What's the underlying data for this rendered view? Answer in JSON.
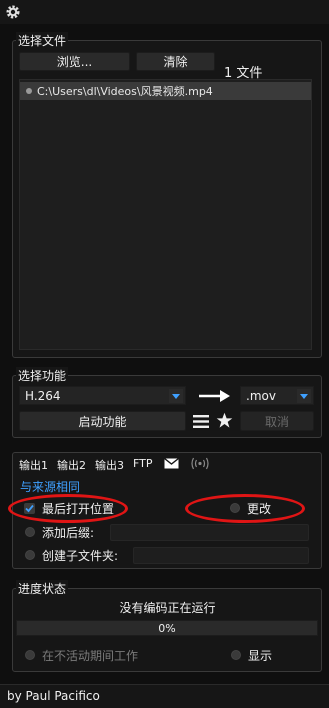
{
  "select_files": {
    "title": "选择文件",
    "browse_label": "浏览...",
    "clear_label": "清除",
    "file_count": "1 文件",
    "files": [
      "C:\\Users\\dl\\Videos\\风景视频.mp4"
    ]
  },
  "select_function": {
    "title": "选择功能",
    "codec": "H.264",
    "container": ".mov",
    "start_label": "启动功能",
    "cancel_label": "取消"
  },
  "output": {
    "tabs": [
      "输出1",
      "输出2",
      "输出3",
      "FTP"
    ],
    "same_as_source": "与来源相同",
    "last_open_location": "最后打开位置",
    "change_label": "更改",
    "add_suffix": "添加后缀:",
    "create_subfolder": "创建子文件夹:"
  },
  "progress": {
    "title": "进度状态",
    "status_text": "没有编码正在运行",
    "percent_text": "0%",
    "percent_value": 0,
    "inactive_work": "在不活动期间工作",
    "show_label": "显示"
  },
  "footer": {
    "credit": "by Paul Pacifico"
  },
  "colors": {
    "accent": "#3fa0ff",
    "highlight": "#e01515"
  },
  "icons": [
    "gear-icon",
    "arrow-right-icon",
    "menu-icon",
    "star-icon",
    "mail-icon",
    "broadcast-icon"
  ]
}
